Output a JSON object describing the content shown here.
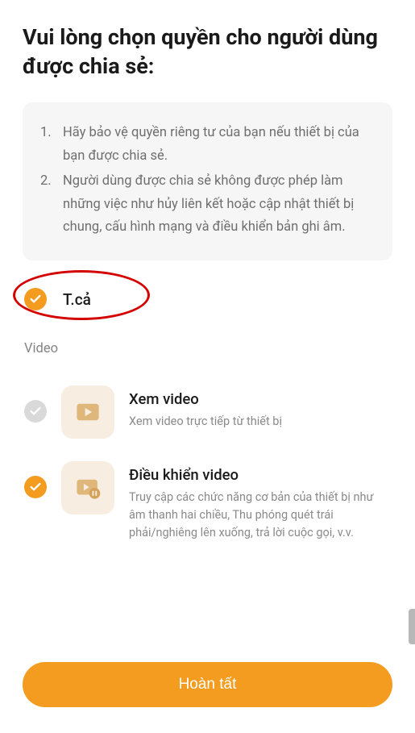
{
  "title": "Vui lòng chọn quyền cho người dùng được chia sẻ:",
  "info": {
    "items": [
      "Hãy bảo vệ quyền riêng tư của bạn nếu thiết bị của bạn được chia sẻ.",
      "Người dùng được chia sẻ không được phép làm những việc như hủy liên kết hoặc cập nhật thiết bị chung, cấu hình mạng và điều khiển bản ghi âm."
    ]
  },
  "select_all": {
    "label": "T.cả",
    "checked": true
  },
  "section_label": "Video",
  "permissions": [
    {
      "title": "Xem video",
      "desc": "Xem video trực tiếp từ thiết bị",
      "checked": false,
      "icon": "play"
    },
    {
      "title": "Điều khiển video",
      "desc": "Truy cập các chức năng cơ bản của thiết bị như âm thanh hai chiều, Thu phóng quét trái phải/nghiêng lên xuống, trả lời cuộc gọi, v.v.",
      "checked": true,
      "icon": "play-pause"
    }
  ],
  "complete_button": "Hoàn tất",
  "colors": {
    "accent": "#f39c1f",
    "highlight": "#d40000"
  }
}
